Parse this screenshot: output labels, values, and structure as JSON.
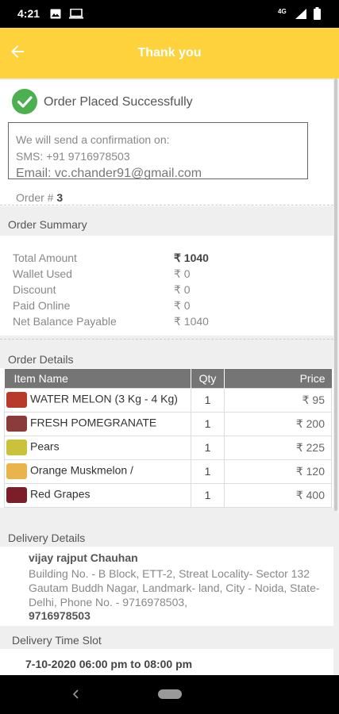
{
  "status_bar": {
    "time": "4:21",
    "network": "4G"
  },
  "app_bar": {
    "title": "Thank you"
  },
  "confirmation": {
    "heading": "Order Placed Successfully",
    "line1": "We will send a confirmation on:",
    "sms": "SMS: +91 9716978503",
    "email": "Email: vc.chander91@gmail.com",
    "order_label": "Order #",
    "order_number": "3"
  },
  "order_summary": {
    "heading": "Order Summary",
    "rows": [
      {
        "label": "Total Amount",
        "value": "₹ 1040"
      },
      {
        "label": "Wallet Used",
        "value": "₹ 0"
      },
      {
        "label": "Discount",
        "value": "₹ 0"
      },
      {
        "label": "Paid Online",
        "value": "₹ 0"
      },
      {
        "label": "Net Balance Payable",
        "value": "₹ 1040"
      }
    ]
  },
  "order_details": {
    "heading": "Order Details",
    "columns": {
      "item": "Item Name",
      "qty": "Qty",
      "price": "Price"
    },
    "items": [
      {
        "name": "WATER MELON (3 Kg - 4 Kg)",
        "qty": "1",
        "price": "₹ 95",
        "thumb_color": "#b83a2a"
      },
      {
        "name": "FRESH POMEGRANATE",
        "qty": "1",
        "price": "₹ 200",
        "thumb_color": "#8c3b3b"
      },
      {
        "name": "Pears",
        "qty": "1",
        "price": "₹ 225",
        "thumb_color": "#c9c23a"
      },
      {
        "name": "Orange Muskmelon /",
        "qty": "1",
        "price": "₹ 120",
        "thumb_color": "#e9b54a"
      },
      {
        "name": "Red Grapes",
        "qty": "1",
        "price": "₹ 400",
        "thumb_color": "#7a1f2a"
      }
    ]
  },
  "delivery_details": {
    "heading": "Delivery Details",
    "name": "vijay rajput Chauhan",
    "address_line1": "Building No. - B Block,  ETT-2, Streat Locality- Sector 132",
    "address_line2": "Gautam Buddh Nagar, Landmark- land, City - Noida, State-",
    "address_line3": "Delhi, Phone No. - 9716978503,",
    "phone": "9716978503"
  },
  "delivery_slot": {
    "heading": "Delivery Time Slot",
    "value": "7-10-2020  06:00 pm to 08:00 pm"
  },
  "colors": {
    "accent": "#fdd23c",
    "success": "#4caf50",
    "table_header": "#757575"
  }
}
